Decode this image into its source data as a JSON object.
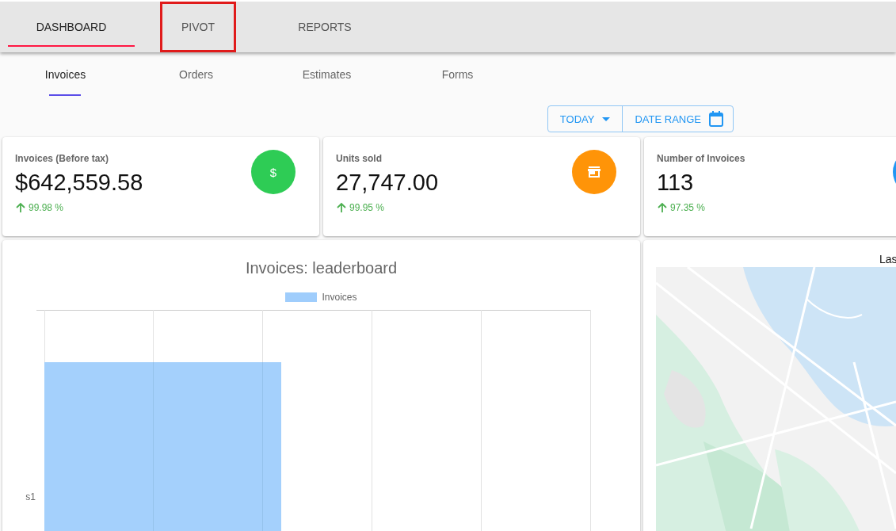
{
  "tabs": [
    {
      "label": "DASHBOARD",
      "selected": true,
      "highlighted": false
    },
    {
      "label": "PIVOT",
      "selected": false,
      "highlighted": true
    },
    {
      "label": "REPORTS",
      "selected": false,
      "highlighted": false
    }
  ],
  "subtabs": [
    {
      "label": "Invoices",
      "selected": true
    },
    {
      "label": "Orders",
      "selected": false
    },
    {
      "label": "Estimates",
      "selected": false
    },
    {
      "label": "Forms",
      "selected": false
    }
  ],
  "date_filter": {
    "period": "TODAY",
    "range": "DATE RANGE"
  },
  "cards": [
    {
      "title": "Invoices (Before tax)",
      "value": "$642,559.58",
      "change": "99.98 %",
      "increase": true,
      "kind": "dollar",
      "icon_text": "$",
      "color": "#2ecc55"
    },
    {
      "title": "Units sold",
      "value": "27,747.00",
      "change": "99.95 %",
      "increase": true,
      "kind": "store",
      "color": "#ff9408"
    },
    {
      "title": "Number of Invoices",
      "value": "113",
      "change": "97.35 %",
      "increase": true,
      "kind": "other",
      "color": "#2196f3"
    }
  ],
  "chart": {
    "title": "Invoices: leaderboard",
    "legend": "Invoices",
    "category": "s1"
  },
  "map_panel": {
    "heading": "Las"
  }
}
